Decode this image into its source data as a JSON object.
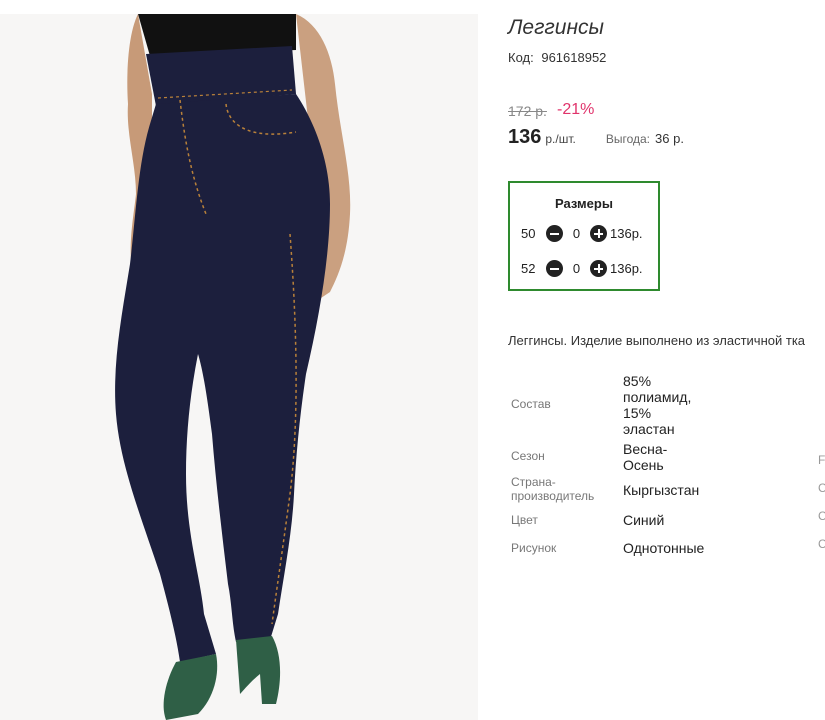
{
  "product": {
    "title": "Леггинсы",
    "code_label": "Код:",
    "code_value": "961618952",
    "old_price": "172 р.",
    "discount": "-21%",
    "price": "136",
    "price_unit": "р./шт.",
    "benefit_label": "Выгода:",
    "benefit_value": "36 р."
  },
  "sizes": {
    "title": "Размеры",
    "rows": [
      {
        "size": "50",
        "qty": "0",
        "price": "136р."
      },
      {
        "size": "52",
        "qty": "0",
        "price": "136р."
      }
    ]
  },
  "description": "Леггинсы. Изделие выполнено из эластичной тка",
  "specs": [
    {
      "label": "Состав",
      "value": "85% полиамид, 15% эластан"
    },
    {
      "label": "Сезон",
      "value": "Весна-Осень"
    },
    {
      "label": "Страна-производитель",
      "value": "Кыргызстан"
    },
    {
      "label": "Цвет",
      "value": "Синий"
    },
    {
      "label": "Рисунок",
      "value": "Однотонные"
    }
  ],
  "edge_chars": [
    "F",
    "С",
    "С",
    "С"
  ],
  "colors": {
    "discount": "#e0336b",
    "sizes_border": "#2e8a2e",
    "cart_button": "#b9dc3a",
    "product": "#1c1f3d",
    "stitching": "#b9813a"
  }
}
